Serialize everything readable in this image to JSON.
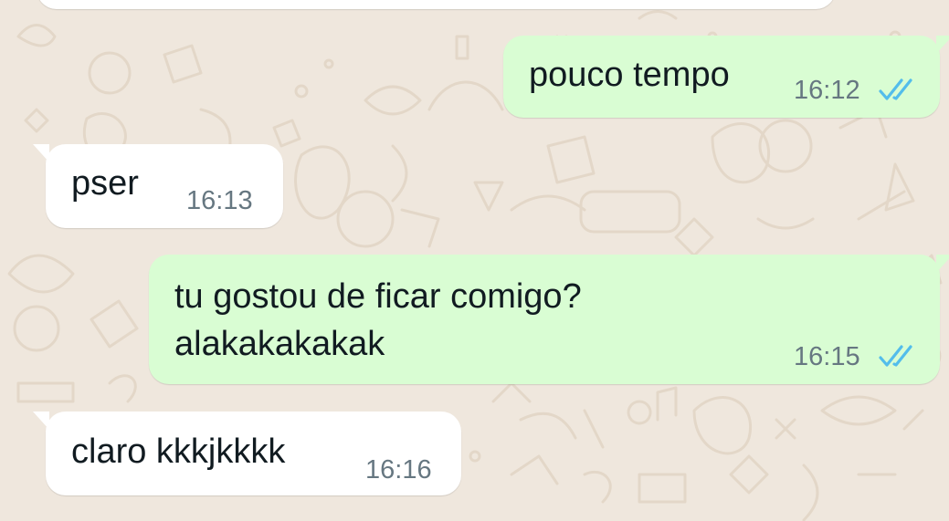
{
  "chat": {
    "messages": [
      {
        "direction": "outgoing",
        "text": "pouco tempo",
        "time": "16:12",
        "status": "read"
      },
      {
        "direction": "incoming",
        "text": "pser",
        "time": "16:13"
      },
      {
        "direction": "outgoing",
        "text": "tu gostou de ficar comigo?\nalakakakakak",
        "time": "16:15",
        "status": "read"
      },
      {
        "direction": "incoming",
        "text": "claro kkkjkkkk",
        "time": "16:16"
      }
    ]
  },
  "colors": {
    "background": "#efe7dd",
    "incoming_bubble": "#ffffff",
    "outgoing_bubble": "#d9fdd3",
    "read_ticks": "#53bdeb",
    "time_text": "#667781"
  }
}
